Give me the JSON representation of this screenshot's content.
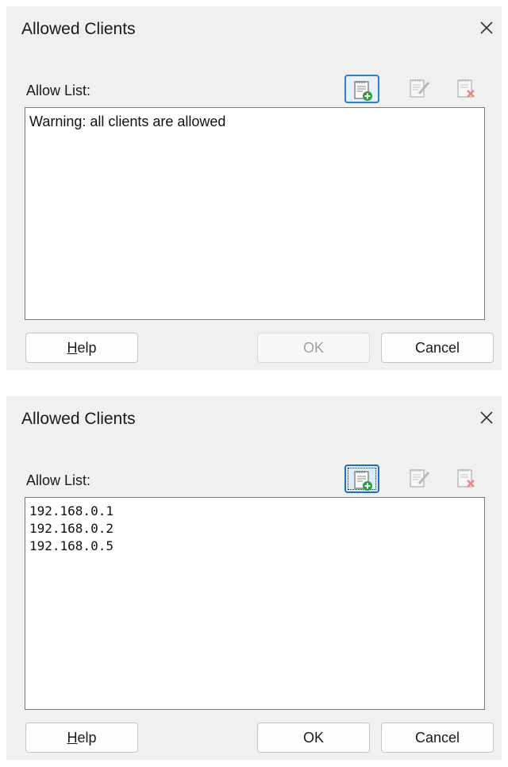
{
  "dialogs": [
    {
      "title": "Allowed Clients",
      "allow_list_label": "Allow List:",
      "list_rows": [
        "Warning: all clients are allowed"
      ],
      "buttons": {
        "help_accel": "H",
        "help_rest": "elp",
        "ok": "OK",
        "ok_enabled": false,
        "cancel": "Cancel"
      },
      "toolbar": {
        "add_icon": "add-item-icon",
        "edit_icon": "edit-item-icon",
        "delete_icon": "delete-item-icon"
      }
    },
    {
      "title": "Allowed Clients",
      "allow_list_label": "Allow List:",
      "list_rows": [
        "192.168.0.1",
        "192.168.0.2",
        "192.168.0.5"
      ],
      "buttons": {
        "help_accel": "H",
        "help_rest": "elp",
        "ok": "OK",
        "ok_enabled": true,
        "cancel": "Cancel"
      },
      "toolbar": {
        "add_icon": "add-item-icon",
        "edit_icon": "edit-item-icon",
        "delete_icon": "delete-item-icon"
      }
    }
  ],
  "colors": {
    "dialog_bg": "#f0f0f0",
    "focus_border": "#2f7fd0",
    "add_green": "#2e9e3a",
    "delete_red": "#d9342b"
  }
}
